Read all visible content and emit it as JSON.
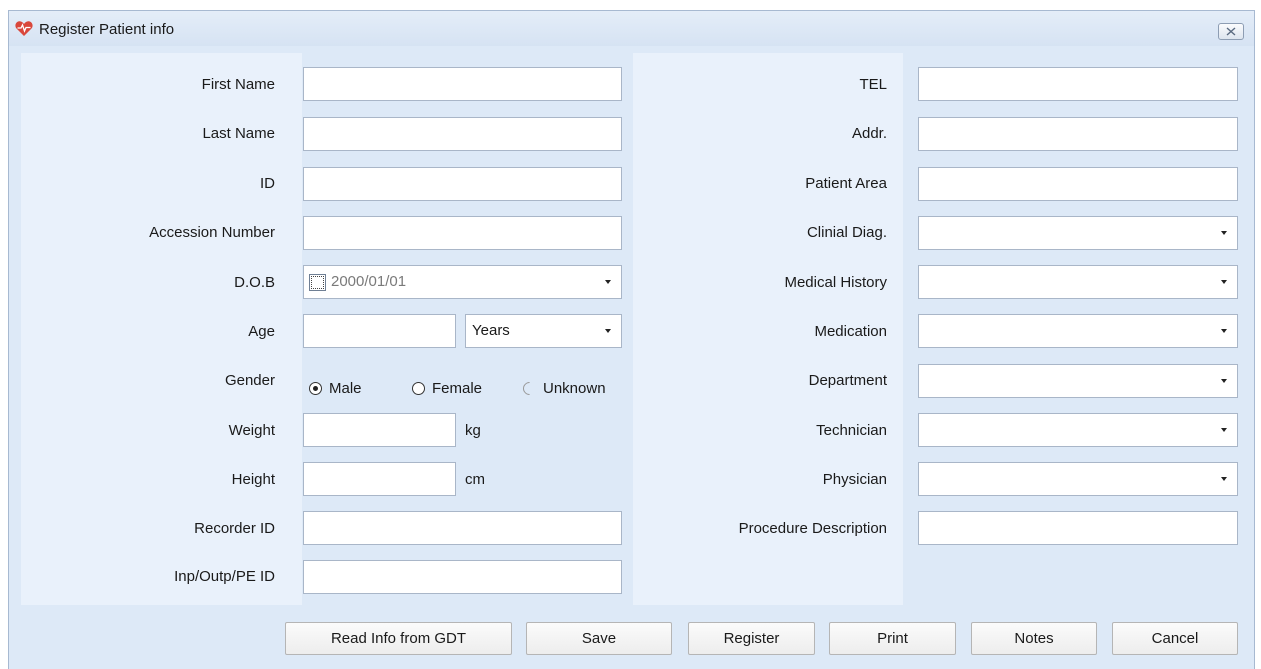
{
  "window": {
    "title": "Register Patient info",
    "close_label": "⊠"
  },
  "left_form": {
    "first_name": {
      "label": "First Name",
      "value": ""
    },
    "last_name": {
      "label": "Last Name",
      "value": ""
    },
    "id": {
      "label": "ID",
      "value": ""
    },
    "accession_number": {
      "label": "Accession Number",
      "value": ""
    },
    "dob": {
      "label": "D.O.B",
      "value": "2000/01/01",
      "checked": false
    },
    "age": {
      "label": "Age",
      "value": "",
      "unit": "Years"
    },
    "gender": {
      "label": "Gender",
      "options": [
        "Male",
        "Female",
        "Unknown"
      ],
      "selected": "Male"
    },
    "weight": {
      "label": "Weight",
      "value": "",
      "unit": "kg"
    },
    "height": {
      "label": "Height",
      "value": "",
      "unit": "cm"
    },
    "recorder_id": {
      "label": "Recorder ID",
      "value": ""
    },
    "inp_outp_pe_id": {
      "label": "Inp/Outp/PE ID",
      "value": ""
    }
  },
  "right_form": {
    "tel": {
      "label": "TEL",
      "value": ""
    },
    "addr": {
      "label": "Addr.",
      "value": ""
    },
    "patient_area": {
      "label": "Patient Area",
      "value": ""
    },
    "clinical_diag": {
      "label": "Clinial Diag.",
      "value": ""
    },
    "medical_history": {
      "label": "Medical History",
      "value": ""
    },
    "medication": {
      "label": "Medication",
      "value": ""
    },
    "department": {
      "label": "Department",
      "value": ""
    },
    "technician": {
      "label": "Technician",
      "value": ""
    },
    "physician": {
      "label": "Physician",
      "value": ""
    },
    "procedure_description": {
      "label": "Procedure Description",
      "value": ""
    }
  },
  "buttons": {
    "read_gdt": "Read Info from GDT",
    "save": "Save",
    "register": "Register",
    "print": "Print",
    "notes": "Notes",
    "cancel": "Cancel"
  }
}
